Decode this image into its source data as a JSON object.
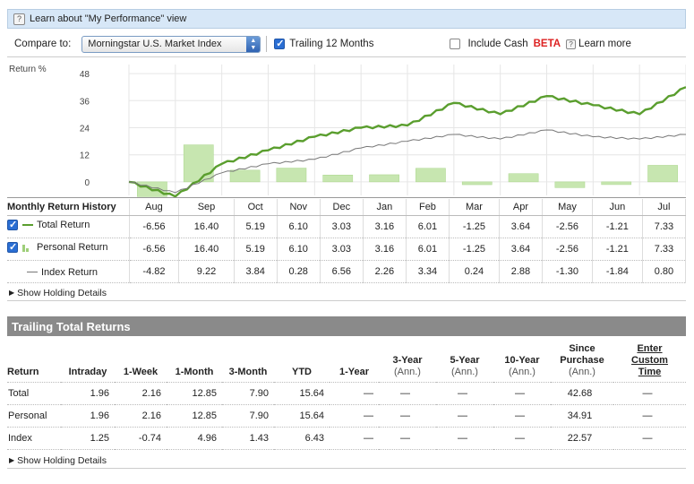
{
  "learn": {
    "text": "Learn about \"My Performance\" view"
  },
  "controls": {
    "compare_label": "Compare to:",
    "compare_value": "Morningstar U.S. Market Index",
    "trailing_label": "Trailing 12 Months",
    "trailing_checked": true,
    "cash_label": "Include Cash",
    "cash_checked": false,
    "beta": "BETA",
    "learn_more": "Learn more"
  },
  "chart_data": {
    "type": "line",
    "ylabel": "Return %",
    "yticks": [
      0,
      12,
      24,
      36,
      48
    ],
    "ylim": [
      -6,
      52
    ],
    "categories": [
      "Aug",
      "Sep",
      "Oct",
      "Nov",
      "Dec",
      "Jan",
      "Feb",
      "Mar",
      "Apr",
      "May",
      "Jun",
      "Jul"
    ],
    "bars": [
      -6.56,
      16.4,
      5.19,
      6.1,
      3.03,
      3.16,
      6.01,
      -1.25,
      3.64,
      -2.56,
      -1.21,
      7.33
    ],
    "series": [
      {
        "name": "Total Return",
        "color": "#5a9e2e",
        "values": [
          0,
          -6.5,
          8,
          14,
          20,
          24,
          25,
          35,
          30,
          38,
          34,
          30,
          42
        ]
      },
      {
        "name": "Index Return",
        "color": "#777777",
        "values": [
          0,
          -4.8,
          4,
          8,
          10,
          15,
          18,
          21,
          19,
          23,
          20,
          19,
          21
        ]
      }
    ]
  },
  "history": {
    "header": "Monthly Return History",
    "months": [
      "Aug",
      "Sep",
      "Oct",
      "Nov",
      "Dec",
      "Jan",
      "Feb",
      "Mar",
      "Apr",
      "May",
      "Jun",
      "Jul"
    ],
    "rows": [
      {
        "label": "Total Return",
        "values": [
          "-6.56",
          "16.40",
          "5.19",
          "6.10",
          "3.03",
          "3.16",
          "6.01",
          "-1.25",
          "3.64",
          "-2.56",
          "-1.21",
          "7.33"
        ]
      },
      {
        "label": "Personal Return",
        "values": [
          "-6.56",
          "16.40",
          "5.19",
          "6.10",
          "3.03",
          "3.16",
          "6.01",
          "-1.25",
          "3.64",
          "-2.56",
          "-1.21",
          "7.33"
        ]
      },
      {
        "label": "Index Return",
        "values": [
          "-4.82",
          "9.22",
          "3.84",
          "0.28",
          "6.56",
          "2.26",
          "3.34",
          "0.24",
          "2.88",
          "-1.30",
          "-1.84",
          "0.80"
        ]
      }
    ]
  },
  "show_holding_details": "Show Holding Details",
  "trailing": {
    "title": "Trailing Total Returns",
    "headers": [
      {
        "main": "Return",
        "ann": ""
      },
      {
        "main": "Intraday",
        "ann": ""
      },
      {
        "main": "1-Week",
        "ann": ""
      },
      {
        "main": "1-Month",
        "ann": ""
      },
      {
        "main": "3-Month",
        "ann": ""
      },
      {
        "main": "YTD",
        "ann": ""
      },
      {
        "main": "1-Year",
        "ann": ""
      },
      {
        "main": "3-Year",
        "ann": "(Ann.)"
      },
      {
        "main": "5-Year",
        "ann": "(Ann.)"
      },
      {
        "main": "10-Year",
        "ann": "(Ann.)"
      },
      {
        "main": "Since Purchase",
        "ann": "(Ann.)"
      },
      {
        "main": "Enter Custom Time",
        "ann": ""
      }
    ],
    "rows": [
      [
        "Total",
        "1.96",
        "2.16",
        "12.85",
        "7.90",
        "15.64",
        "—",
        "—",
        "—",
        "—",
        "42.68",
        "—"
      ],
      [
        "Personal",
        "1.96",
        "2.16",
        "12.85",
        "7.90",
        "15.64",
        "—",
        "—",
        "—",
        "—",
        "34.91",
        "—"
      ],
      [
        "Index",
        "1.25",
        "-0.74",
        "4.96",
        "1.43",
        "6.43",
        "—",
        "—",
        "—",
        "—",
        "22.57",
        "—"
      ]
    ]
  }
}
